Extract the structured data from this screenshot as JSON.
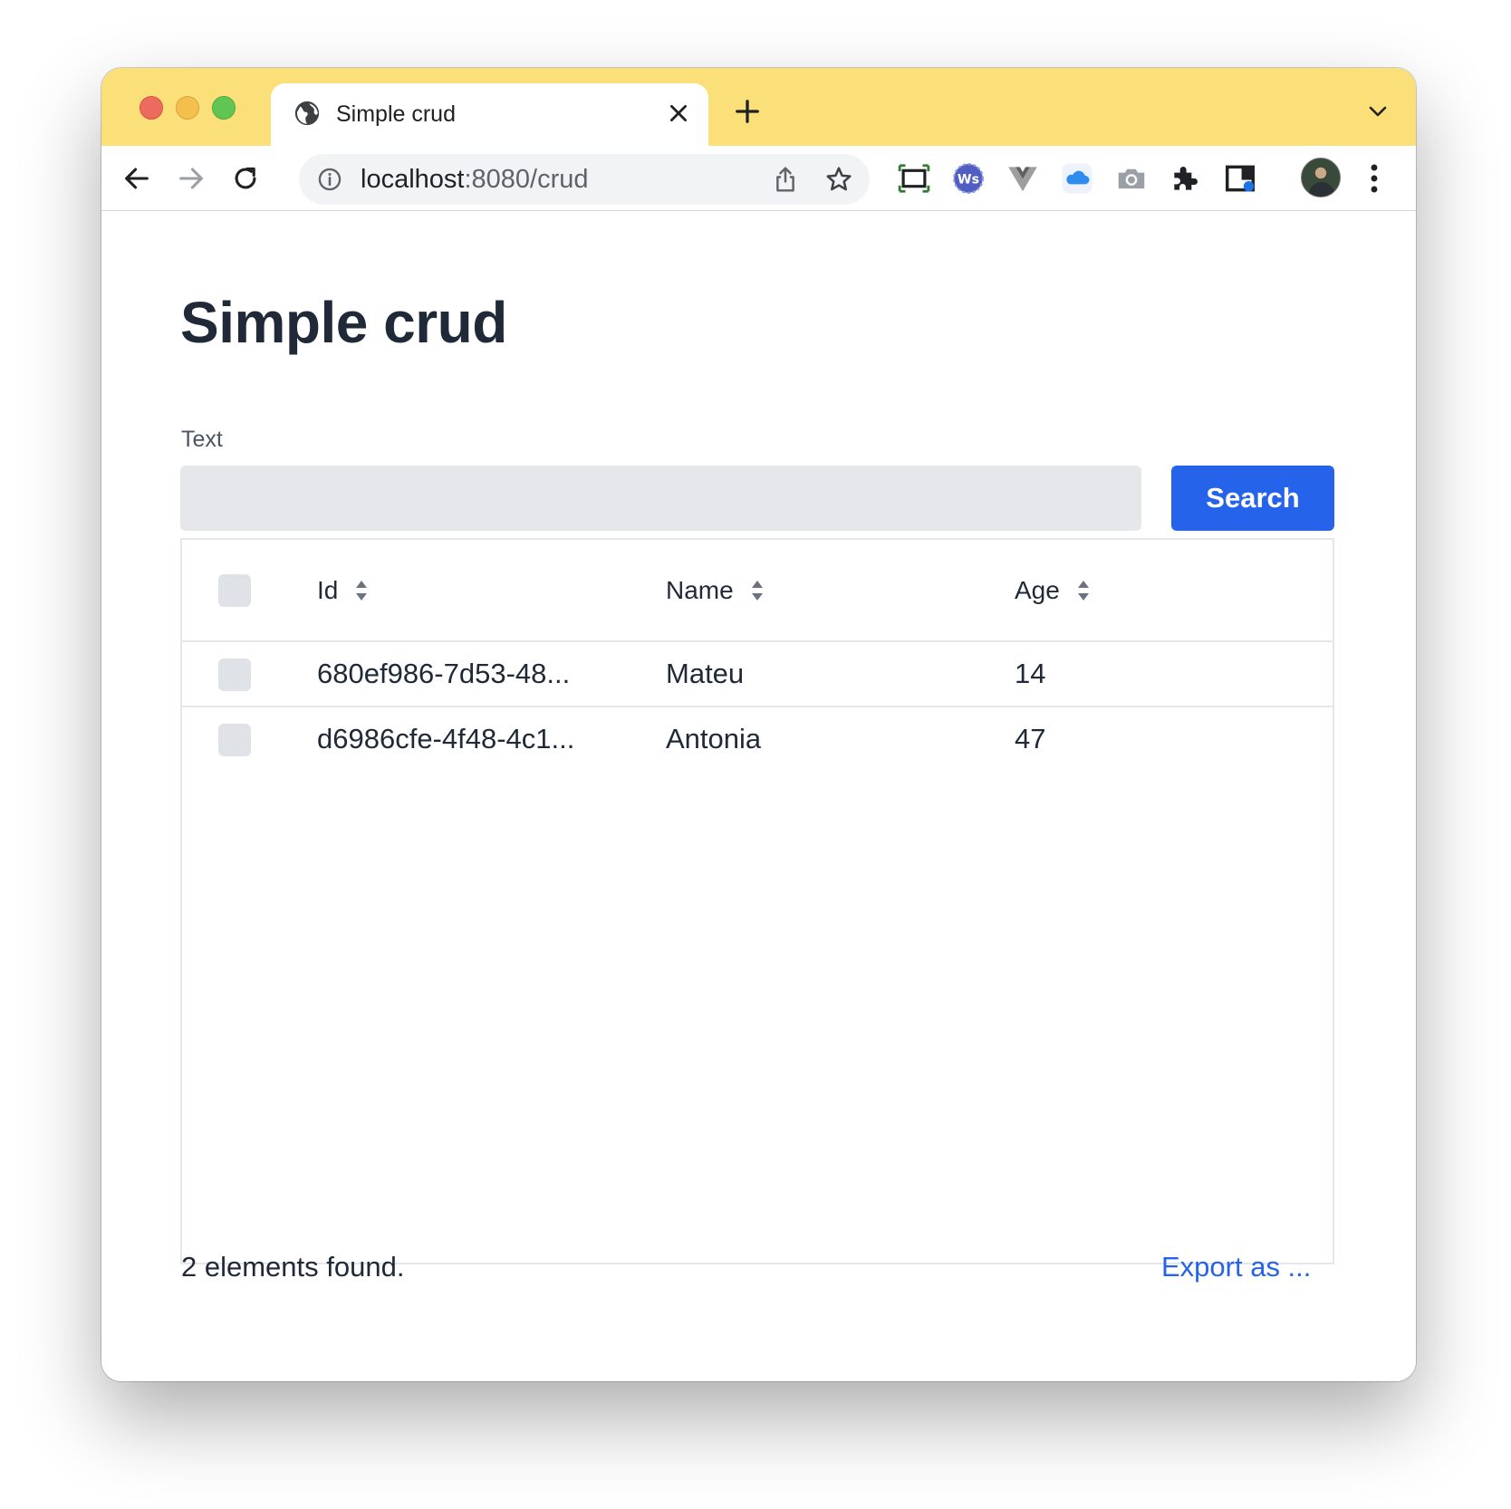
{
  "browser": {
    "tab_title": "Simple crud",
    "url_host": "localhost",
    "url_rest": ":8080/crud",
    "accent_color": "#fbe07a"
  },
  "page": {
    "title": "Simple crud",
    "search": {
      "label": "Text",
      "value": "",
      "button_label": "Search"
    },
    "table": {
      "columns": [
        "Id",
        "Name",
        "Age"
      ],
      "rows": [
        {
          "id": "680ef986-7d53-48...",
          "name": "Mateu",
          "age": "14"
        },
        {
          "id": "d6986cfe-4f48-4c1...",
          "name": "Antonia",
          "age": "47"
        }
      ]
    },
    "footer": {
      "count_text": "2 elements found.",
      "export_label": "Export as ..."
    }
  },
  "colors": {
    "primary": "#2563eb",
    "text": "#1f2937"
  }
}
